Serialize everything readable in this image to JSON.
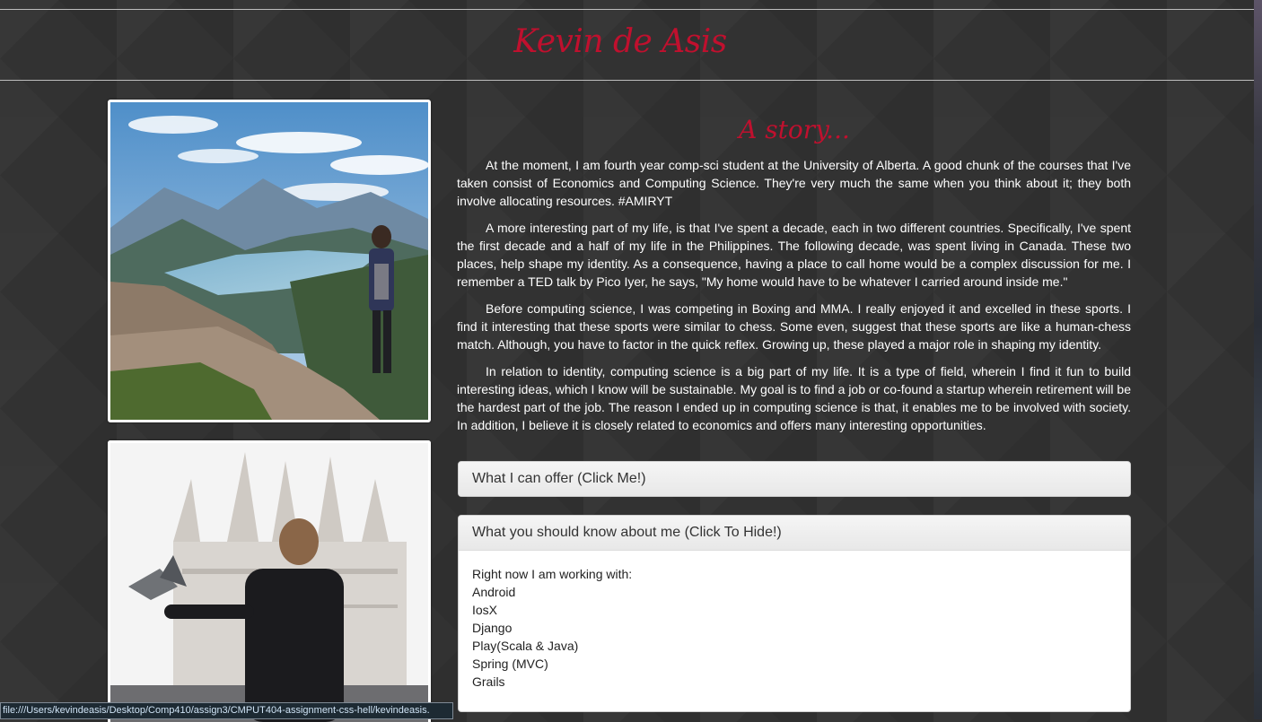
{
  "header": {
    "title": "Kevin de Asis"
  },
  "story": {
    "heading": "A story...",
    "paragraphs": [
      "At the moment, I am fourth year comp-sci student at the University of Alberta. A good chunk of the courses that I've taken consist of Economics and Computing Science. They're very much the same when you think about it; they both involve allocating resources. #AMIRYT",
      "A more interesting part of my life, is that I've spent a decade, each in two different countries. Specifically, I've spent the first decade and a half of my life in the Philippines. The following decade, was spent living in Canada. These two places, help shape my identity. As a consequence, having a place to call home would be a complex discussion for me. I remember a TED talk by Pico Iyer, he says, \"My home would have to be whatever I carried around inside me.\"",
      "Before computing science, I was competing in Boxing and MMA. I really enjoyed it and excelled in these sports. I find it interesting that these sports were similar to chess. Some even, suggest that these sports are like a human-chess match. Although, you have to factor in the quick reflex. Growing up, these played a major role in shaping my identity.",
      "In relation to identity, computing science is a big part of my life. It is a type of field, wherein I find it fun to build interesting ideas, which I know will be sustainable. My goal is to find a job or co-found a startup wherein retirement will be the hardest part of the job. The reason I ended up in computing science is that, it enables me to be involved with society. In addition, I believe it is closely related to economics and offers many interesting opportunities."
    ]
  },
  "panels": {
    "offer": {
      "title": "What I can offer (Click Me!)"
    },
    "know": {
      "title": "What you should know about me (Click To Hide!)",
      "intro": "Right now I am working with:",
      "items": [
        "Android",
        "IosX",
        "Django",
        "Play(Scala & Java)",
        "Spring (MVC)",
        "Grails"
      ]
    }
  },
  "status_bar": {
    "url": "file:///Users/kevindeasis/Desktop/Comp410/assign3/CMPUT404-assignment-css-hell/kevindeasis."
  },
  "colors": {
    "accent": "#c0102e",
    "background": "#323232"
  }
}
